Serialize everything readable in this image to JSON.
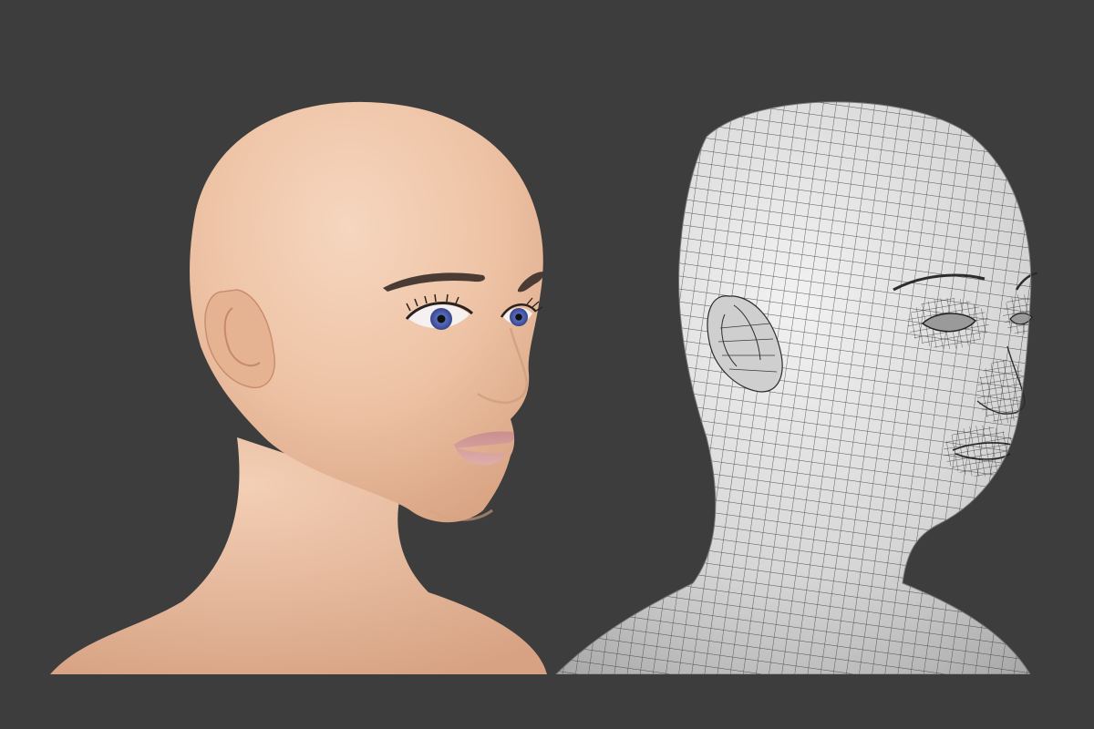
{
  "scene": {
    "background_color": "#3d3d3d",
    "ground_color": "#3b3b3b",
    "left_model": {
      "kind": "shaded-render",
      "skin_color": "#f1c9ad",
      "iris_color": "#5b6fc4",
      "lip_color": "#cf9a98",
      "brow_color": "#4a3c35"
    },
    "right_model": {
      "kind": "wireframe-render",
      "surface_color": "#d9d9d9",
      "wire_color": "#3a3a3a"
    }
  }
}
